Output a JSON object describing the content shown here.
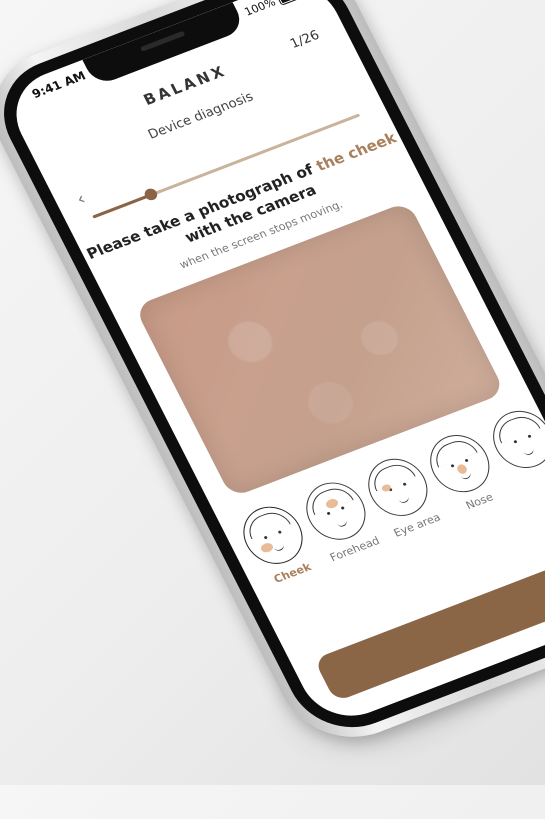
{
  "status": {
    "time": "9:41 AM",
    "battery": "100%"
  },
  "header": {
    "brand": "BALANX",
    "step": "1/26",
    "subtitle": "Device diagnosis"
  },
  "progress": {
    "fraction": 0.22
  },
  "instruction": {
    "line1_prefix": "Please take a photograph of ",
    "line1_highlight": "the cheek",
    "line2": "with the camera",
    "hint": "when the screen stops moving."
  },
  "regions": [
    {
      "label": "Cheek",
      "active": true,
      "icon": "face-cheek-icon"
    },
    {
      "label": "Forehead",
      "active": false,
      "icon": "face-forehead-icon"
    },
    {
      "label": "Eye area",
      "active": false,
      "icon": "face-eye-area-icon"
    },
    {
      "label": "Nose",
      "active": false,
      "icon": "face-nose-icon"
    },
    {
      "label": "",
      "active": false,
      "icon": "face-icon"
    }
  ],
  "colors": {
    "accent": "#a9805c",
    "button": "#8b6646"
  }
}
